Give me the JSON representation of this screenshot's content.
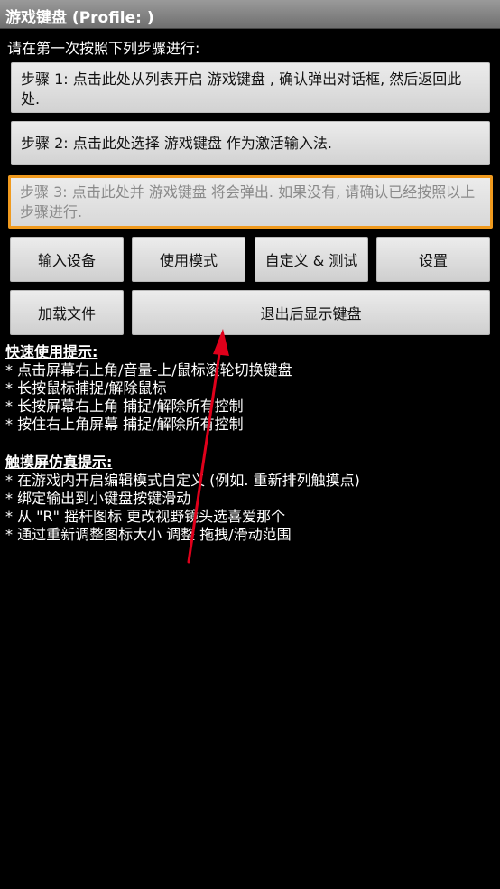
{
  "title": "游戏键盘 (Profile: )",
  "instruction": "请在第一次按照下列步骤进行:",
  "steps": [
    "步骤 1: 点击此处从列表开启 游戏键盘 , 确认弹出对话框, 然后返回此处.",
    "步骤 2: 点击此处选择 游戏键盘 作为激活输入法.",
    "步骤 3: 点击此处并 游戏键盘 将会弹出. 如果没有, 请确认已经按照以上步骤进行."
  ],
  "buttons": {
    "input_device": "输入设备",
    "usage_mode": "使用模式",
    "custom_test": "自定义 & 测试",
    "settings": "设置",
    "load_file": "加载文件",
    "show_keyboard": "退出后显示键盘"
  },
  "quick_tips": {
    "heading": "快速使用提示:",
    "items": [
      "* 点击屏幕右上角/音量-上/鼠标滚轮切换键盘",
      "* 长按鼠标捕捉/解除鼠标",
      "* 长按屏幕右上角 捕捉/解除所有控制",
      "* 按住右上角屏幕 捕捉/解除所有控制"
    ]
  },
  "touch_tips": {
    "heading": "触摸屏仿真提示:",
    "items": [
      "* 在游戏内开启编辑模式自定义 (例如. 重新排列触摸点)",
      "* 绑定输出到小键盘按键滑动",
      "* 从 \"R\" 摇杆图标 更改视野镜头选喜爱那个",
      "* 通过重新调整图标大小 调整 拖拽/滑动范围"
    ]
  },
  "colors": {
    "focus_border": "#f09a1e",
    "annotation_arrow": "#e0001b"
  }
}
